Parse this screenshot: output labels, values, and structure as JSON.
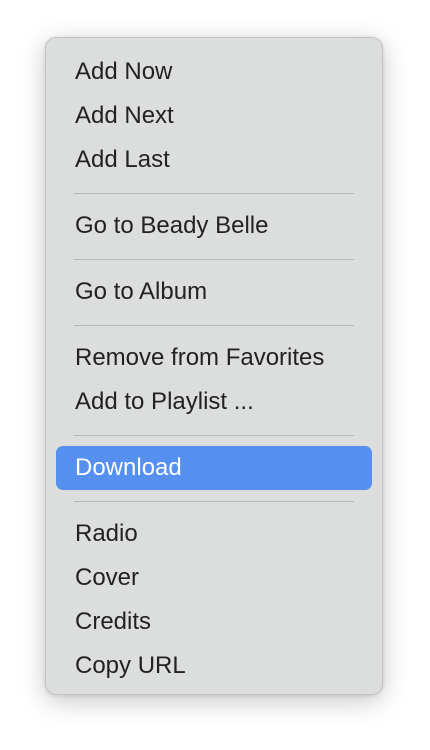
{
  "menu": {
    "groups": [
      {
        "items": [
          {
            "label": "Add Now"
          },
          {
            "label": "Add Next"
          },
          {
            "label": "Add Last"
          }
        ]
      },
      {
        "items": [
          {
            "label": "Go to Beady Belle"
          }
        ]
      },
      {
        "items": [
          {
            "label": "Go to Album"
          }
        ]
      },
      {
        "items": [
          {
            "label": "Remove from Favorites"
          },
          {
            "label": "Add to Playlist ..."
          }
        ]
      },
      {
        "items": [
          {
            "label": "Download",
            "highlighted": true
          }
        ]
      },
      {
        "items": [
          {
            "label": "Radio"
          },
          {
            "label": "Cover"
          },
          {
            "label": "Credits"
          },
          {
            "label": "Copy URL"
          }
        ]
      }
    ],
    "highlight_color": "#5590f0"
  }
}
